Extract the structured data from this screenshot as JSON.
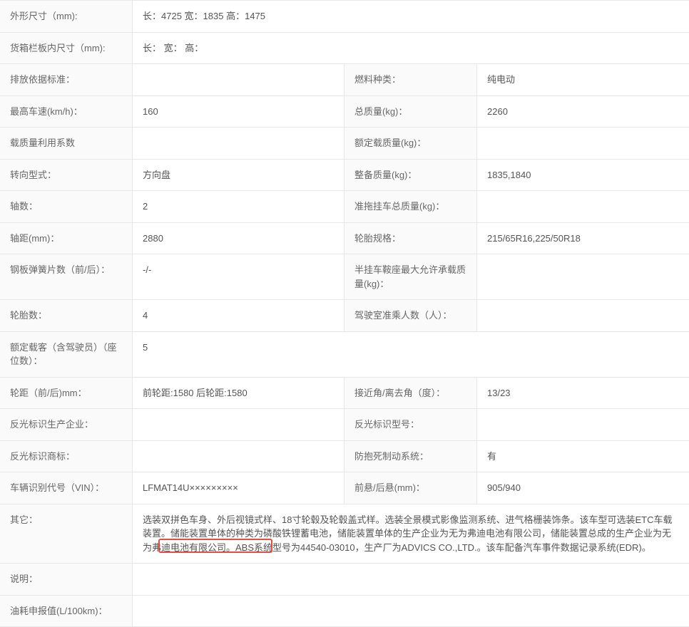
{
  "rows": [
    {
      "type": "full",
      "label": "外形尺寸（mm):",
      "value": "长：4725 宽：1835 高：1475"
    },
    {
      "type": "full",
      "label": "货箱栏板内尺寸（mm):",
      "value": "长： 宽： 高："
    },
    {
      "type": "quad",
      "label1": "排放依据标准：",
      "value1": "",
      "label2": "燃料种类：",
      "value2": "纯电动"
    },
    {
      "type": "quad",
      "label1": "最高车速(km/h)：",
      "value1": "160",
      "label2": "总质量(kg)：",
      "value2": "2260"
    },
    {
      "type": "quad",
      "label1": "载质量利用系数",
      "value1": "",
      "label2": "额定载质量(kg)：",
      "value2": ""
    },
    {
      "type": "quad",
      "label1": "转向型式：",
      "value1": "方向盘",
      "label2": "整备质量(kg)：",
      "value2": "1835,1840"
    },
    {
      "type": "quad",
      "label1": "轴数：",
      "value1": "2",
      "label2": "准拖挂车总质量(kg)：",
      "value2": ""
    },
    {
      "type": "quad",
      "label1": "轴距(mm)：",
      "value1": "2880",
      "label2": "轮胎规格：",
      "value2": "215/65R16,225/50R18"
    },
    {
      "type": "quad",
      "label1": "钢板弹簧片数（前/后）：",
      "value1": "-/-",
      "label2": "半挂车鞍座最大允许承载质量(kg)：",
      "value2": ""
    },
    {
      "type": "quad",
      "label1": "轮胎数：",
      "value1": "4",
      "label2": "驾驶室准乘人数（人）：",
      "value2": ""
    },
    {
      "type": "full",
      "label": "额定载客（含驾驶员）（座位数）：",
      "value": "5"
    },
    {
      "type": "quad",
      "label1": "轮距（前/后)mm：",
      "value1": "前轮距:1580 后轮距:1580",
      "label2": "接近角/离去角（度）：",
      "value2": "13/23"
    },
    {
      "type": "quad",
      "label1": "反光标识生产企业：",
      "value1": "",
      "label2": "反光标识型号：",
      "value2": ""
    },
    {
      "type": "quad",
      "label1": "反光标识商标：",
      "value1": "",
      "label2": "防抱死制动系统：",
      "value2": "有"
    },
    {
      "type": "quad",
      "label1": "车辆识别代号（VIN）：",
      "value1": "LFMAT14U×××××××××",
      "label2": "前悬/后悬(mm)：",
      "value2": "905/940"
    },
    {
      "type": "full",
      "label": "其它：",
      "value": "选装双拼色车身、外后视镜式样、18寸轮毂及轮毂盖式样。选装全景模式影像监测系统、进气格栅装饰条。该车型可选装ETC车载装置。储能装置单体的种类为磷酸铁锂蓄电池，储能装置单体的生产企业为无为弗迪电池有限公司，储能装置总成的生产企业为无为弗迪电池有限公司。ABS系统型号为44540-03010，生产厂为ADVICS CO.,LTD.。该车配备汽车事件数据记录系统(EDR)。",
      "highlight": true
    },
    {
      "type": "full",
      "label": "说明：",
      "value": ""
    },
    {
      "type": "full",
      "label": "油耗申报值(L/100km)：",
      "value": ""
    }
  ]
}
